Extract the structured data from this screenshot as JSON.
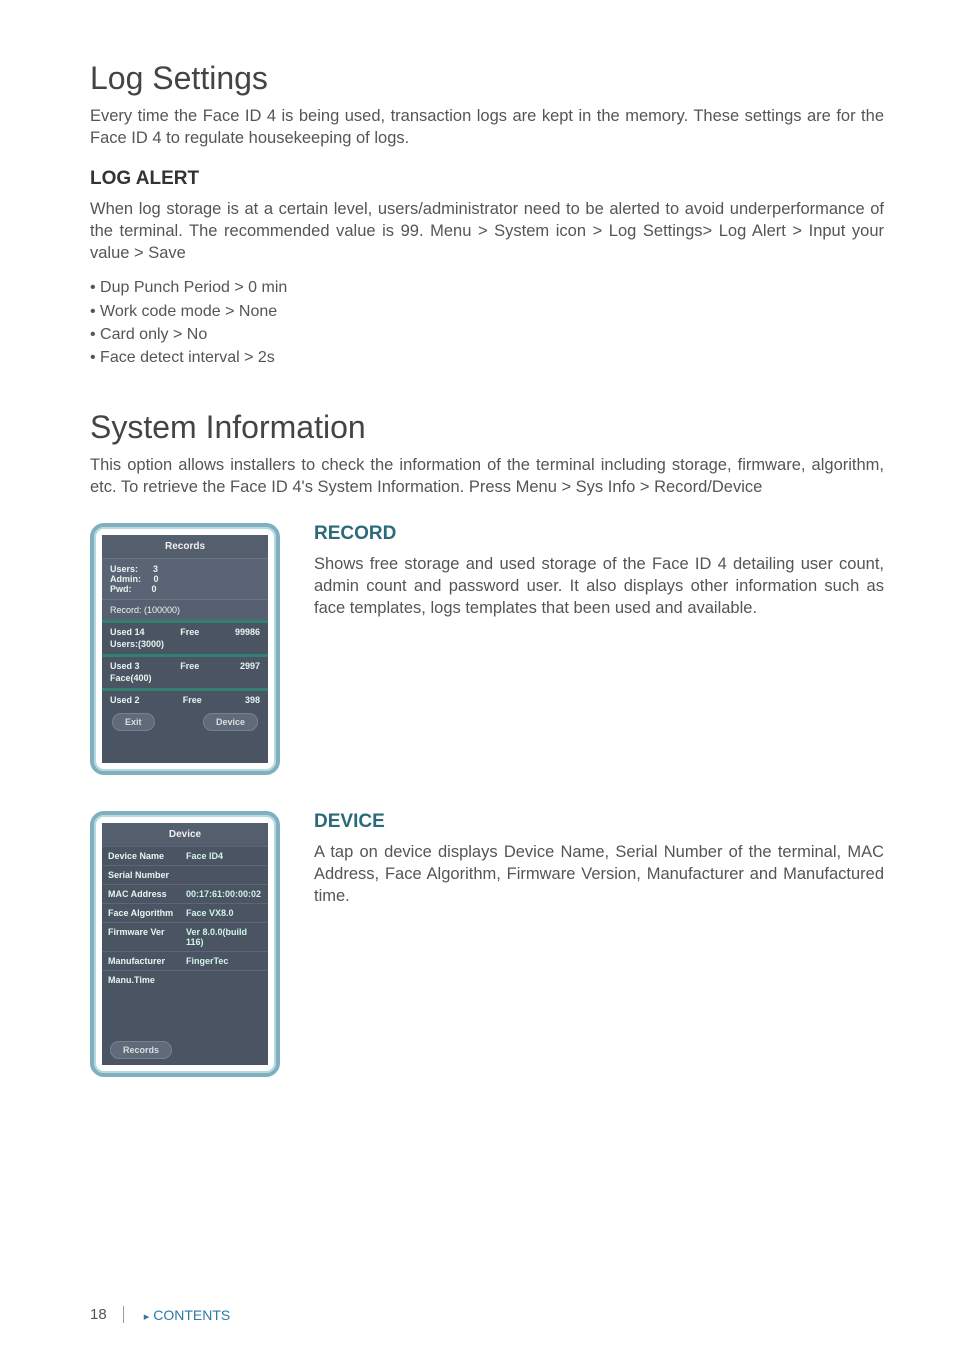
{
  "log_settings": {
    "title": "Log Settings",
    "intro": "Every time the Face ID 4 is being used, transaction logs are kept in the memory. These settings are for the Face ID 4 to regulate housekeeping of logs.",
    "log_alert_heading": "LOG ALERT",
    "log_alert_body": "When log storage is at a certain level, users/administrator need to be alerted to avoid underperformance of the terminal. The recommended value is 99. Menu > System icon > Log Settings> Log Alert > Input your value > Save",
    "bullets": [
      "• Dup Punch Period > 0 min",
      "• Work code mode > None",
      "• Card only > No",
      "• Face detect interval > 2s"
    ]
  },
  "system_info": {
    "title": "System Information",
    "intro": "This option allows installers to check the information of the terminal including storage, firmware, algorithm, etc. To retrieve the Face ID 4's System Information. Press Menu > Sys Info > Record/Device"
  },
  "record_section": {
    "heading": "RECORD",
    "body": "Shows free storage and used storage of the Face ID 4 detailing user count, admin count and password user. It also displays other information such as face templates, logs templates that been used and available."
  },
  "device_section": {
    "heading": "DEVICE",
    "body": "A tap on device displays Device Name, Serial Number of the terminal, MAC Address, Face Algorithm, Firmware Version, Manufacturer and Manufactured time."
  },
  "records_screen": {
    "title": "Records",
    "users_label": "Users:",
    "users_value": "3",
    "admin_label": "Admin:",
    "admin_value": "0",
    "pwd_label": "Pwd:",
    "pwd_value": "0",
    "record_label": "Record: (100000)",
    "row1_used": "Used  14",
    "row1_free": "Free",
    "row1_val": "99986",
    "row1_sub": "Users:(3000)",
    "row2_used": "Used  3",
    "row2_free": "Free",
    "row2_val": "2997",
    "row2_sub": "Face(400)",
    "row3_used": "Used  2",
    "row3_free": "Free",
    "row3_val": "398",
    "exit_btn": "Exit",
    "device_btn": "Device"
  },
  "device_screen": {
    "title": "Device",
    "rows": [
      {
        "label": "Device Name",
        "value": "Face ID4"
      },
      {
        "label": "Serial Number",
        "value": ""
      },
      {
        "label": "MAC Address",
        "value": "00:17:61:00:00:02"
      },
      {
        "label": "Face Algorithm",
        "value": "Face VX8.0"
      },
      {
        "label": "Firmware Ver",
        "value": "Ver 8.0.0(build 116)"
      },
      {
        "label": "Manufacturer",
        "value": "FingerTec"
      },
      {
        "label": "Manu.Time",
        "value": ""
      }
    ],
    "records_btn": "Records"
  },
  "footer": {
    "page": "18",
    "contents": "CONTENTS"
  }
}
